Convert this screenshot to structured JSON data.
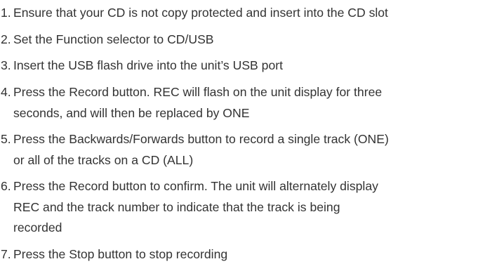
{
  "steps": [
    {
      "number": "1.",
      "text": "Ensure that your CD is not copy protected and insert into the CD slot"
    },
    {
      "number": "2.",
      "text": "Set the Function selector to CD/USB"
    },
    {
      "number": "3.",
      "text": "Insert the USB flash drive into the unit’s USB port"
    },
    {
      "number": "4.",
      "text": "Press the Record button. REC will flash on the unit display for three\nseconds, and will then be replaced by ONE"
    },
    {
      "number": "5.",
      "text": "Press the Backwards/Forwards button to record a single track (ONE)\nor all of the tracks on a CD (ALL)"
    },
    {
      "number": "6.",
      "text": "Press the Record button to confirm. The unit will alternately display\nREC and the track number to indicate that the track is being\nrecorded"
    },
    {
      "number": "7.",
      "text": "Press the Stop button to stop recording"
    }
  ]
}
